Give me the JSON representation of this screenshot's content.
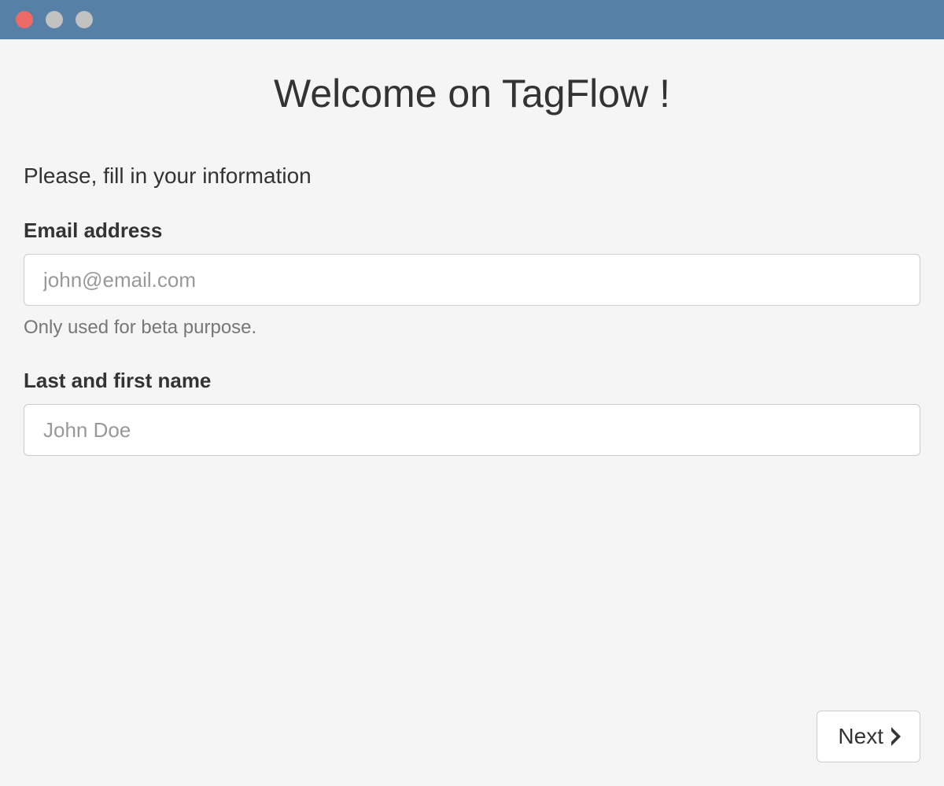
{
  "header": {
    "title": "Welcome on TagFlow !"
  },
  "form": {
    "prompt": "Please, fill in your information",
    "email": {
      "label": "Email address",
      "placeholder": "john@email.com",
      "value": "",
      "help": "Only used for beta purpose."
    },
    "name": {
      "label": "Last and first name",
      "placeholder": "John Doe",
      "value": ""
    }
  },
  "actions": {
    "next_label": "Next"
  }
}
